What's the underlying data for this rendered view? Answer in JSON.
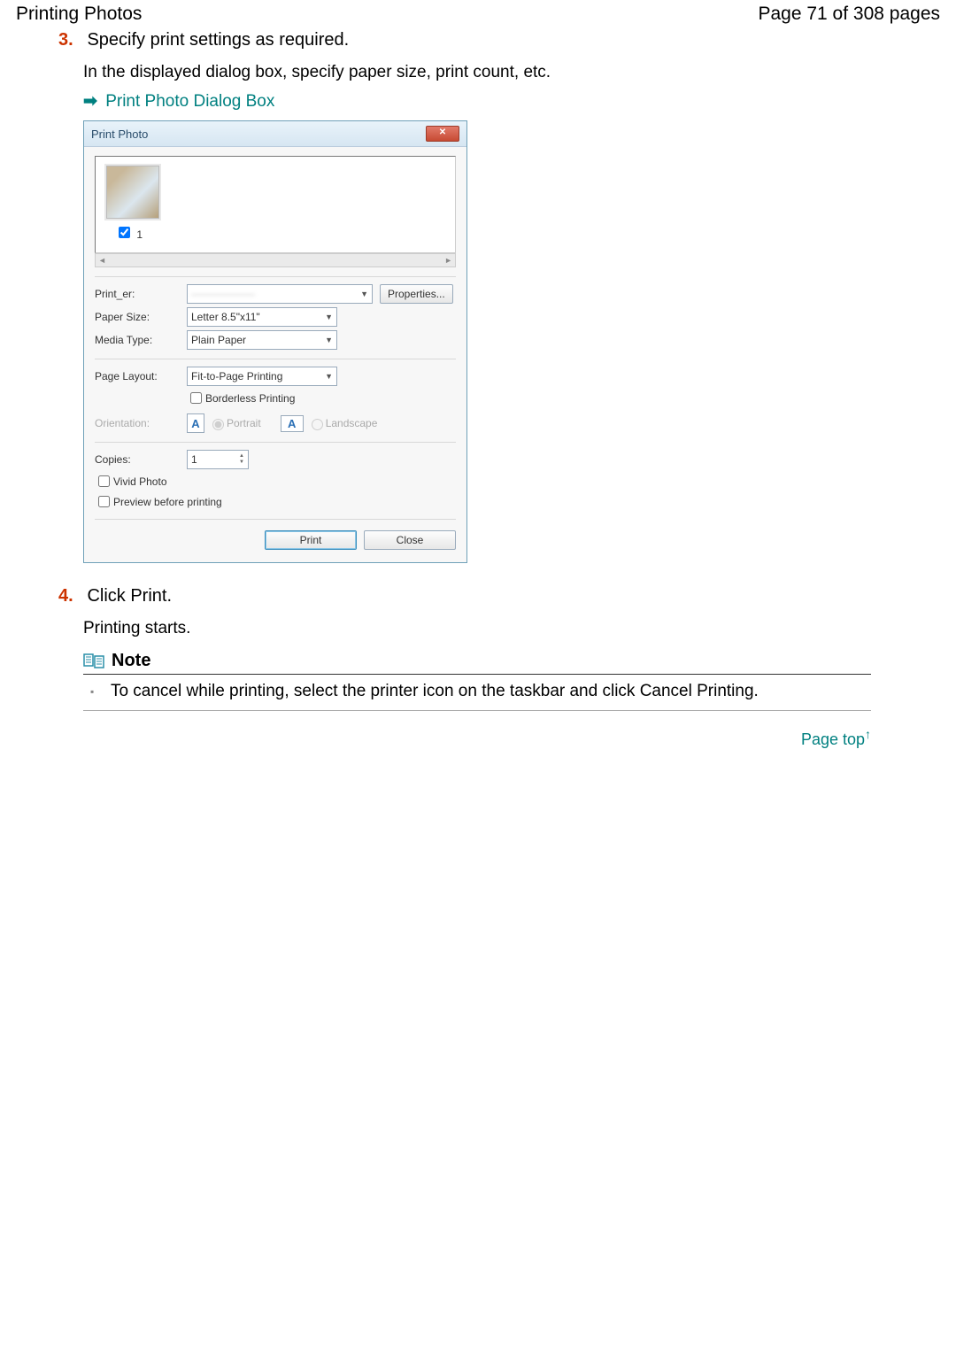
{
  "header": {
    "title": "Printing Photos",
    "page": "Page 71 of 308 pages"
  },
  "step3": {
    "num": "3.",
    "title": "Specify print settings as required.",
    "sub": "In the displayed dialog box, specify paper size, print count, etc.",
    "link_label": "Print Photo Dialog Box"
  },
  "dialog": {
    "title": "Print Photo",
    "thumb_index": "1",
    "rows": {
      "printer_label": "Print_er:",
      "printer_value": "",
      "properties_btn": "Properties...",
      "papersize_label": "Paper Size:",
      "papersize_value": "Letter 8.5\"x11\"",
      "mediatype_label": "Media Type:",
      "mediatype_value": "Plain Paper",
      "layout_label": "Page Layout:",
      "layout_value": "Fit-to-Page Printing",
      "borderless_label": "Borderless Printing",
      "orientation_label": "Orientation:",
      "portrait_icon": "A",
      "portrait_label": "Portrait",
      "landscape_icon": "A",
      "landscape_label": "Landscape",
      "copies_label": "Copies:",
      "copies_value": "1",
      "vivid_label": "Vivid Photo",
      "preview_label": "Preview before printing",
      "print_btn": "Print",
      "close_btn": "Close"
    }
  },
  "step4": {
    "num": "4.",
    "title": "Click Print.",
    "sub": "Printing starts."
  },
  "note": {
    "title": "Note",
    "body": "To cancel while printing, select the printer icon on the taskbar and click Cancel Printing."
  },
  "pagetop": "Page top"
}
